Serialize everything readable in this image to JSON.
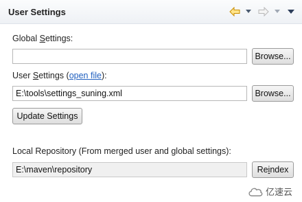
{
  "header": {
    "title": "User Settings",
    "icons": [
      "back-arrow-icon",
      "dropdown-icon",
      "forward-arrow-icon",
      "dropdown-icon",
      "view-menu-icon"
    ],
    "accent_color": "#e0a400"
  },
  "global_settings": {
    "label_pre": "Global ",
    "label_u": "S",
    "label_post": "ettings:",
    "value": "",
    "browse_label": "Browse..."
  },
  "user_settings": {
    "label_pre": "User ",
    "label_u": "S",
    "label_mid": "ettings (",
    "link_text": "open file",
    "label_post": "):",
    "value": "E:\\tools\\settings_suning.xml",
    "browse_label": "Browse..."
  },
  "update_button_label": "Update Settings",
  "local_repository": {
    "label": "Local Repository (From merged user and global settings):",
    "value": "E:\\maven\\repository",
    "reindex_pre": "Re",
    "reindex_u": "i",
    "reindex_post": "ndex"
  },
  "watermark": {
    "text": "亿速云"
  }
}
